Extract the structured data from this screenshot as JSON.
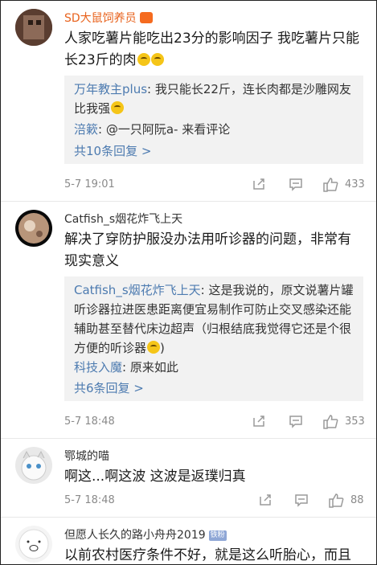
{
  "comments": [
    {
      "name": "SD大鼠饲养员",
      "name_color": "#e8621c",
      "text": "人家吃薯片能吃出23分的影响因子 我吃薯片只能长23斤的肉",
      "replies": [
        {
          "user": "万年教主plus",
          "text": ": 我只能长22斤，连长肉都是沙雕网友比我强"
        },
        {
          "user": "涪簌",
          "text": ": @一只阿阮a- 来看评论"
        }
      ],
      "more": "共10条回复 >",
      "time": "5-7 19:01",
      "likes": "433"
    },
    {
      "name": "Catfish_s烟花炸飞上天",
      "name_color": "#333333",
      "text": "解决了穿防护服没办法用听诊器的问题，非常有现实意义",
      "replies": [
        {
          "user": "Catfish_s烟花炸飞上天",
          "text": ": 这是我说的，原文说薯片罐听诊器拉进医患距离便宜易制作可防止交叉感染还能辅助甚至替代床边超声（归根结底我觉得它还是个很方便的听诊器"
        },
        {
          "user": "科技入魔",
          "text": ": 原来如此"
        }
      ],
      "more": "共6条回复 >",
      "time": "5-7 18:48",
      "likes": "353"
    },
    {
      "name": "鄂城的喵",
      "name_color": "#333333",
      "text": "啊这...啊这波 这波是返璞归真",
      "time": "5-7 18:48",
      "likes": "88"
    },
    {
      "name": "但愿人长久的路小舟舟2019",
      "name_color": "#333333",
      "badge": "铁粉",
      "text": "以前农村医疗条件不好，就是这么听胎心，而且"
    }
  ],
  "icons": {
    "share": "share-icon",
    "comment": "comment-icon",
    "like": "like-icon"
  }
}
